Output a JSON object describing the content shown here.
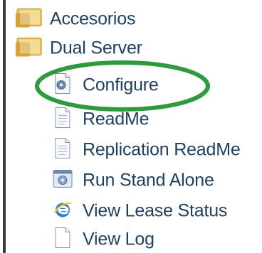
{
  "menu": {
    "items": [
      {
        "label": "Accesorios",
        "icon": "folder-icon"
      },
      {
        "label": "Dual Server",
        "icon": "folder-icon"
      },
      {
        "label": "Configure",
        "icon": "config-file-icon",
        "highlighted": true
      },
      {
        "label": "ReadMe",
        "icon": "text-document-icon"
      },
      {
        "label": "Replication ReadMe",
        "icon": "text-document-icon"
      },
      {
        "label": "Run Stand Alone",
        "icon": "application-icon"
      },
      {
        "label": "View Lease Status",
        "icon": "internet-explorer-icon"
      },
      {
        "label": "View Log",
        "icon": "blank-document-icon"
      }
    ]
  },
  "colors": {
    "text": "#1f3f5f",
    "highlight_ellipse": "#2e9a3c",
    "folder_yellow": "#e8b84a",
    "tree_line": "#3a3a3a"
  }
}
